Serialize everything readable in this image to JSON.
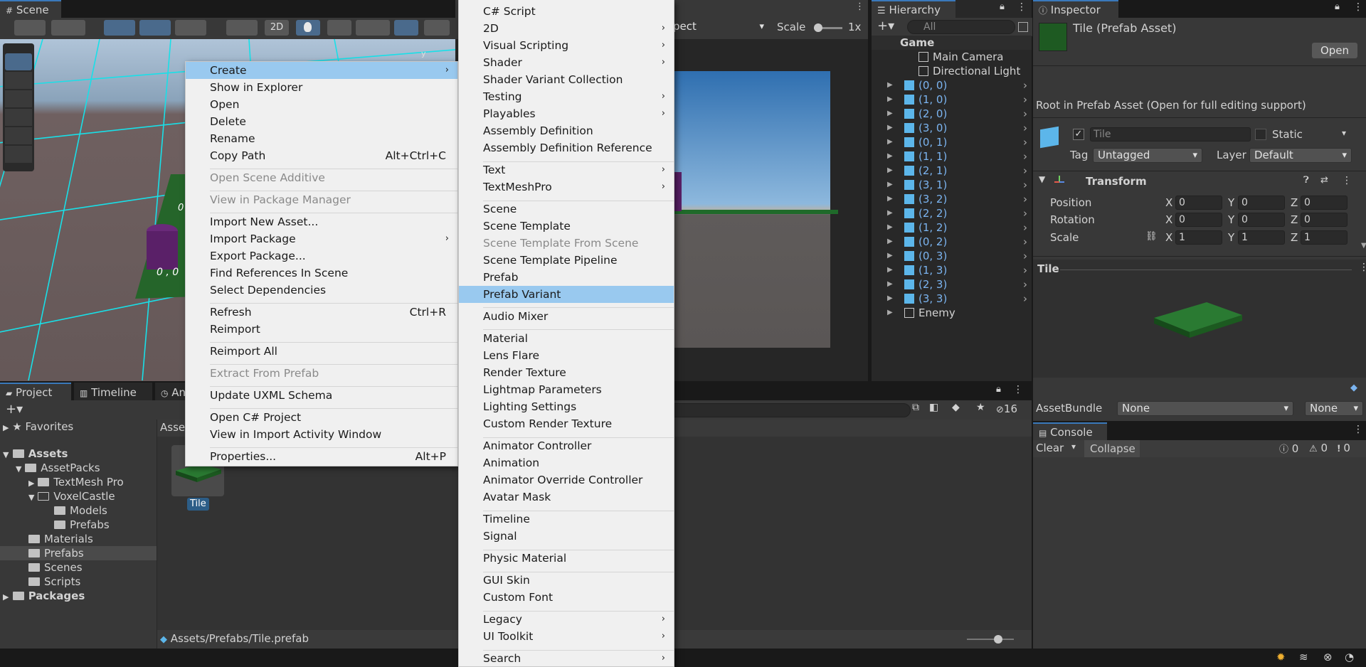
{
  "scene_tab": "Scene",
  "scene_toolbar": {
    "two_d": "2D"
  },
  "scene_labels": {
    "tile_label_a": "0 ,",
    "tile_label_b": "0 , 0",
    "tile_label_c": "0",
    "axis_y": "y"
  },
  "game_toolbar": {
    "aspect": "pect",
    "scale_label": "Scale",
    "scale_value": "1x"
  },
  "hierarchy": {
    "tab": "Hierarchy",
    "search_placeholder": "All",
    "root": "Game",
    "items": [
      "Main Camera",
      "Directional Light",
      "(0, 0)",
      "(1, 0)",
      "(2, 0)",
      "(3, 0)",
      "(0, 1)",
      "(1, 1)",
      "(2, 1)",
      "(3, 1)",
      "(3, 2)",
      "(2, 2)",
      "(1, 2)",
      "(0, 2)",
      "(0, 3)",
      "(1, 3)",
      "(2, 3)",
      "(3, 3)",
      "Enemy"
    ]
  },
  "inspector": {
    "tab": "Inspector",
    "title": "Tile (Prefab Asset)",
    "open_button": "Open",
    "root_notice": "Root in Prefab Asset (Open for full editing support)",
    "name_value": "Tile",
    "static_label": "Static",
    "tag_label": "Tag",
    "tag_value": "Untagged",
    "layer_label": "Layer",
    "layer_value": "Default",
    "transform_label": "Transform",
    "position_label": "Position",
    "rotation_label": "Rotation",
    "scale_label": "Scale",
    "position": {
      "x": "0",
      "y": "0",
      "z": "0"
    },
    "rotation": {
      "x": "0",
      "y": "0",
      "z": "0"
    },
    "scale": {
      "x": "1",
      "y": "1",
      "z": "1"
    },
    "axis_x": "X",
    "axis_y": "Y",
    "axis_z": "Z",
    "preview_title": "Tile",
    "assetbundle_label": "AssetBundle",
    "assetbundle_value": "None",
    "assetbundle_variant": "None"
  },
  "console": {
    "tab": "Console",
    "clear": "Clear",
    "collapse": "Collapse",
    "log_count": "0",
    "warn_count": "0",
    "error_count": "0"
  },
  "project": {
    "tabs": [
      "Project",
      "Timeline",
      "An"
    ],
    "hidden_count": "16",
    "breadcrumb": "Asse",
    "tree": {
      "favorites": "Favorites",
      "assets": "Assets",
      "assetpacks": "AssetPacks",
      "textmeshpro": "TextMesh Pro",
      "voxelcastle": "VoxelCastle",
      "models": "Models",
      "prefabs_sub": "Prefabs",
      "materials": "Materials",
      "prefabs": "Prefabs",
      "scenes": "Scenes",
      "scripts": "Scripts",
      "packages": "Packages"
    },
    "asset_name": "Tile",
    "path": "Assets/Prefabs/Tile.prefab"
  },
  "context_menu": [
    {
      "label": "Create",
      "arrow": "›",
      "state": "highlight"
    },
    {
      "label": "Show in Explorer"
    },
    {
      "label": "Open"
    },
    {
      "label": "Delete"
    },
    {
      "label": "Rename"
    },
    {
      "label": "Copy Path",
      "shortcut": "Alt+Ctrl+C"
    },
    {
      "label": "Open Scene Additive",
      "state": "disabled"
    },
    {
      "label": "View in Package Manager",
      "state": "disabled"
    },
    {
      "label": "Import New Asset..."
    },
    {
      "label": "Import Package",
      "arrow": "›"
    },
    {
      "label": "Export Package..."
    },
    {
      "label": "Find References In Scene"
    },
    {
      "label": "Select Dependencies"
    },
    {
      "label": "Refresh",
      "shortcut": "Ctrl+R"
    },
    {
      "label": "Reimport"
    },
    {
      "label": "Reimport All"
    },
    {
      "label": "Extract From Prefab",
      "state": "disabled"
    },
    {
      "label": "Update UXML Schema"
    },
    {
      "label": "Open C# Project"
    },
    {
      "label": "View in Import Activity Window"
    },
    {
      "label": "Properties...",
      "shortcut": "Alt+P"
    }
  ],
  "submenu": [
    {
      "label": "C# Script"
    },
    {
      "label": "2D",
      "arrow": "›"
    },
    {
      "label": "Visual Scripting",
      "arrow": "›"
    },
    {
      "label": "Shader",
      "arrow": "›"
    },
    {
      "label": "Shader Variant Collection"
    },
    {
      "label": "Testing",
      "arrow": "›"
    },
    {
      "label": "Playables",
      "arrow": "›"
    },
    {
      "label": "Assembly Definition"
    },
    {
      "label": "Assembly Definition Reference"
    },
    {
      "label": "Text",
      "arrow": "›"
    },
    {
      "label": "TextMeshPro",
      "arrow": "›"
    },
    {
      "label": "Scene"
    },
    {
      "label": "Scene Template"
    },
    {
      "label": "Scene Template From Scene",
      "state": "disabled"
    },
    {
      "label": "Scene Template Pipeline"
    },
    {
      "label": "Prefab"
    },
    {
      "label": "Prefab Variant",
      "state": "highlight"
    },
    {
      "label": "Audio Mixer"
    },
    {
      "label": "Material"
    },
    {
      "label": "Lens Flare"
    },
    {
      "label": "Render Texture"
    },
    {
      "label": "Lightmap Parameters"
    },
    {
      "label": "Lighting Settings"
    },
    {
      "label": "Custom Render Texture"
    },
    {
      "label": "Animator Controller"
    },
    {
      "label": "Animation"
    },
    {
      "label": "Animator Override Controller"
    },
    {
      "label": "Avatar Mask"
    },
    {
      "label": "Timeline"
    },
    {
      "label": "Signal"
    },
    {
      "label": "Physic Material"
    },
    {
      "label": "GUI Skin"
    },
    {
      "label": "Custom Font"
    },
    {
      "label": "Legacy",
      "arrow": "›"
    },
    {
      "label": "UI Toolkit",
      "arrow": "›"
    },
    {
      "label": "Search",
      "arrow": "›"
    }
  ]
}
